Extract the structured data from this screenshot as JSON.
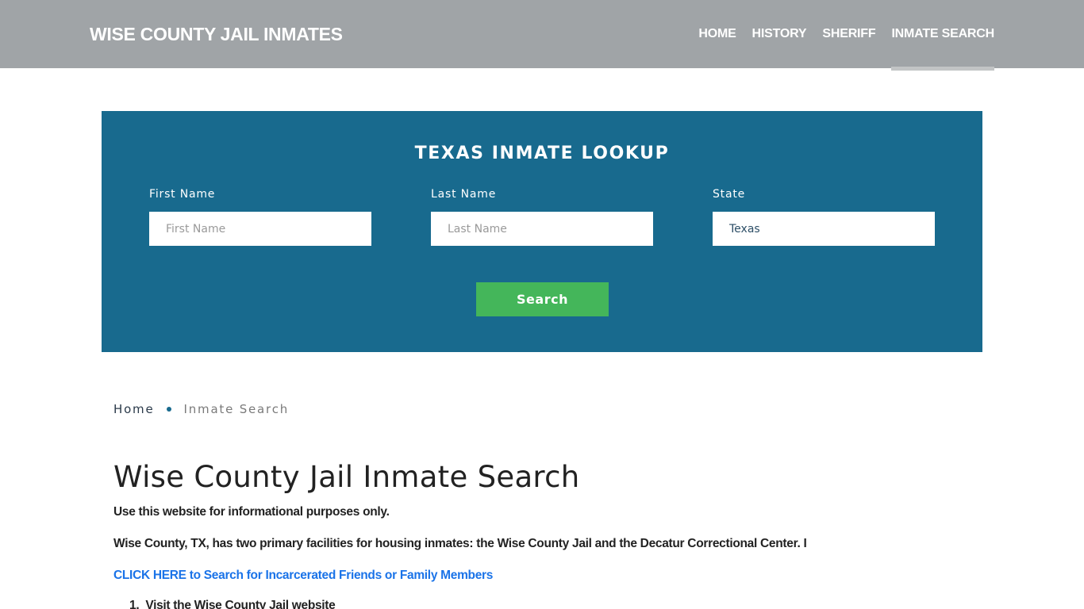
{
  "header": {
    "logo": "WISE COUNTY JAIL INMATES",
    "nav": [
      {
        "label": "HOME",
        "active": false
      },
      {
        "label": "HISTORY",
        "active": false
      },
      {
        "label": "SHERIFF",
        "active": false
      },
      {
        "label": "INMATE SEARCH",
        "active": true
      }
    ]
  },
  "lookup": {
    "title": "TEXAS INMATE LOOKUP",
    "first_name": {
      "label": "First Name",
      "placeholder": "First Name",
      "value": ""
    },
    "last_name": {
      "label": "Last Name",
      "placeholder": "Last Name",
      "value": ""
    },
    "state": {
      "label": "State",
      "value": "Texas"
    },
    "search_label": "Search"
  },
  "breadcrumb": {
    "home": "Home",
    "current": "Inmate Search"
  },
  "content": {
    "title": "Wise County Jail Inmate Search",
    "disclaimer": "Use this website for informational purposes only.",
    "intro": "Wise County, TX, has two primary facilities for housing inmates: the Wise County Jail and the Decatur Correctional Center. I",
    "cta_link": "CLICK HERE to Search for Incarcerated Friends or Family Members",
    "steps": [
      {
        "number": "1.",
        "text": "Visit the Wise County Jail website"
      }
    ]
  },
  "colors": {
    "header_bg": "#a0a4a7",
    "lookup_bg": "#186a8e",
    "search_button": "#44b65a",
    "link": "#1a73e8"
  }
}
